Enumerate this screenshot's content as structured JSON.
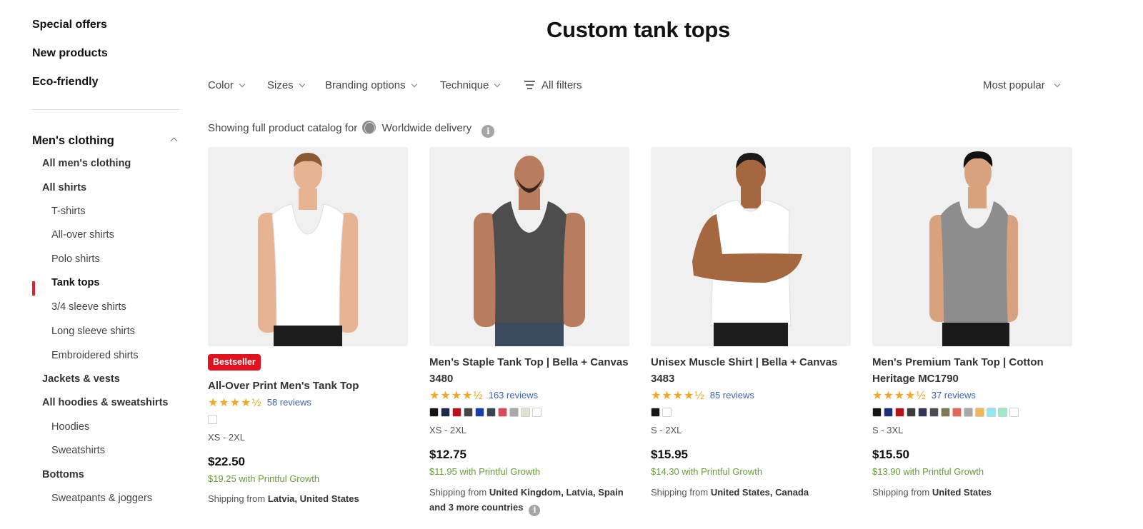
{
  "sidebar": {
    "top_links": [
      "Special offers",
      "New products",
      "Eco-friendly"
    ],
    "section": "Men's clothing",
    "items": [
      {
        "label": "All men's clothing",
        "level": 1
      },
      {
        "label": "All shirts",
        "level": 1
      },
      {
        "label": "T-shirts",
        "level": 2
      },
      {
        "label": "All-over shirts",
        "level": 2
      },
      {
        "label": "Polo shirts",
        "level": 2
      },
      {
        "label": "Tank tops",
        "level": 2,
        "active": true
      },
      {
        "label": "3/4 sleeve shirts",
        "level": 2
      },
      {
        "label": "Long sleeve shirts",
        "level": 2
      },
      {
        "label": "Embroidered shirts",
        "level": 2
      },
      {
        "label": "Jackets & vests",
        "level": 1
      },
      {
        "label": "All hoodies & sweatshirts",
        "level": 1
      },
      {
        "label": "Hoodies",
        "level": 2
      },
      {
        "label": "Sweatshirts",
        "level": 2
      },
      {
        "label": "Bottoms",
        "level": 1
      },
      {
        "label": "Sweatpants & joggers",
        "level": 2
      }
    ],
    "accent_color": "#e3212b"
  },
  "page": {
    "title": "Custom tank tops",
    "filters": [
      "Color",
      "Sizes",
      "Branding options",
      "Technique"
    ],
    "all_filters": "All filters",
    "sort": "Most popular",
    "delivery_prefix": "Showing full product catalog for",
    "delivery_region": "Worldwide delivery"
  },
  "products": [
    {
      "badge": "Bestseller",
      "name": "All-Over Print Men's Tank Top",
      "stars": "★★★★½",
      "rating": 4.5,
      "reviews": "58 reviews",
      "swatches": [
        "#ffffff"
      ],
      "sizes": "XS - 2XL",
      "price": "$22.50",
      "growth_price": "$19.25",
      "growth_label": "with Printful Growth",
      "ship_prefix": "Shipping from",
      "ship_from": "Latvia, United States",
      "ship_more": "",
      "shirt_color": "#ffffff",
      "skin": "#e7b493",
      "hair": "#8a5a35",
      "pants": "#1d1d1d"
    },
    {
      "badge": "",
      "name": "Men’s Staple Tank Top | Bella + Canvas 3480",
      "stars": "★★★★½",
      "rating": 4.5,
      "reviews": "163 reviews",
      "swatches": [
        "#151515",
        "#1c2a47",
        "#b5121b",
        "#444444",
        "#1a3ea8",
        "#38464f",
        "#d64c5b",
        "#a8a8a8",
        "#e6e0d2",
        "#ffffff"
      ],
      "sizes": "XS - 2XL",
      "price": "$12.75",
      "growth_price": "$11.95",
      "growth_label": "with Printful Growth",
      "ship_prefix": "Shipping from",
      "ship_from": "United Kingdom, Latvia, Spain",
      "ship_more": "and 3 more countries",
      "shirt_color": "#4d4d4d",
      "skin": "#b77d5e",
      "hair": "#5b3a28",
      "pants": "#3b4a5e"
    },
    {
      "badge": "",
      "name": "Unisex Muscle Shirt | Bella + Canvas 3483",
      "stars": "★★★★½",
      "rating": 4.5,
      "reviews": "85 reviews",
      "swatches": [
        "#151515",
        "#ffffff"
      ],
      "sizes": "S - 2XL",
      "price": "$15.95",
      "growth_price": "$14.30",
      "growth_label": "with Printful Growth",
      "ship_prefix": "Shipping from",
      "ship_from": "United States, Canada",
      "ship_more": "",
      "shirt_color": "#ffffff",
      "skin": "#a4673f",
      "hair": "#1a1a1a",
      "pants": "#1d1d1d"
    },
    {
      "badge": "",
      "name": "Men's Premium Tank Top | Cotton Heritage MC1790",
      "stars": "★★★★½",
      "rating": 4.5,
      "reviews": "37 reviews",
      "swatches": [
        "#151515",
        "#1b2e7a",
        "#b5121b",
        "#3b3b3b",
        "#2f3656",
        "#4b4d53",
        "#7f7a55",
        "#e3665a",
        "#a7a7a7",
        "#f5b65a",
        "#8fe8f0",
        "#9ee8c8",
        "#ffffff"
      ],
      "sizes": "S - 3XL",
      "price": "$15.50",
      "growth_price": "$13.90",
      "growth_label": "with Printful Growth",
      "ship_prefix": "Shipping from",
      "ship_from": "United States",
      "ship_more": "",
      "shirt_color": "#8d8d8d",
      "skin": "#d8a27f",
      "hair": "#111111",
      "pants": "#1a1a1a"
    }
  ]
}
